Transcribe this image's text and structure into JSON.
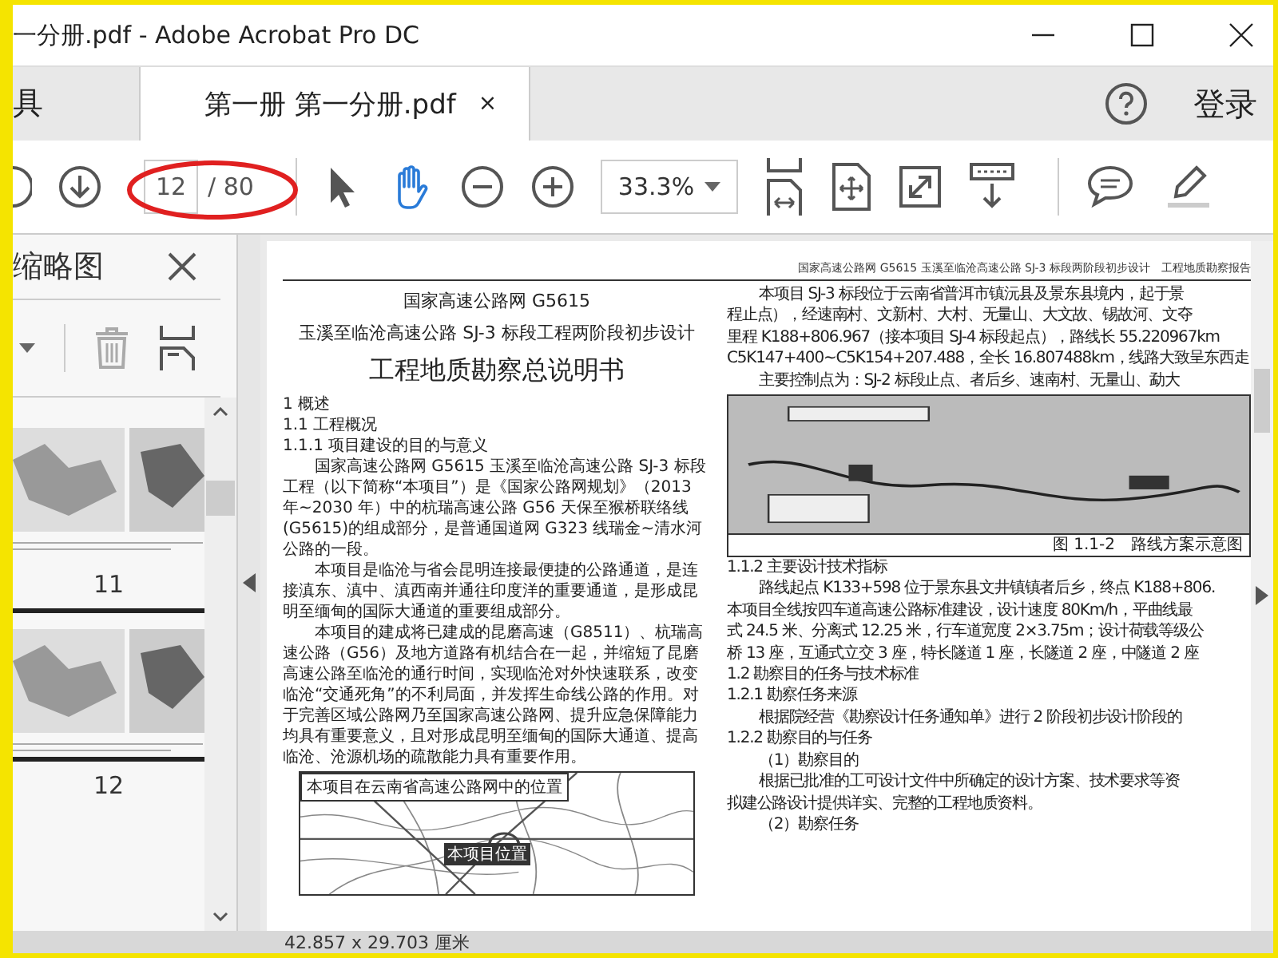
{
  "window": {
    "title": "一分册.pdf - Adobe Acrobat Pro DC"
  },
  "tabs": [
    {
      "label": "具",
      "selected": false
    },
    {
      "label": "第一册 第一分册.pdf",
      "selected": true,
      "close": "×"
    }
  ],
  "account": {
    "label": "登录"
  },
  "toolbar": {
    "page": "12",
    "total": "/ 80",
    "zoom": "33.3%",
    "tools": [
      {
        "kind": "select",
        "selected": false
      },
      {
        "kind": "hand",
        "selected": true
      }
    ]
  },
  "sidebar": {
    "title": "缩略图",
    "thumbnails": [
      {
        "label": "11",
        "selected": false
      },
      {
        "label": "12",
        "selected": true
      }
    ]
  },
  "document": {
    "header": "国家高速公路网 G5615 玉溪至临沧高速公路 SJ-3 标段两阶段初步设计　工程地质勘察报告",
    "titles": [
      "国家高速公路网 G5615",
      "玉溪至临沧高速公路 SJ-3 标段工程两阶段初步设计",
      "工程地质勘察总说明书"
    ],
    "left": [
      {
        "kind": "heading",
        "text": "1 概述"
      },
      {
        "kind": "heading",
        "text": "1.1 工程概况"
      },
      {
        "kind": "heading",
        "text": "1.1.1 项目建设的目的与意义"
      },
      {
        "kind": "para",
        "text": "国家高速公路网 G5615 玉溪至临沧高速公路 SJ-3 标段工程（以下简称“本项目”）是《国家公路网规划》（2013 年~2030 年）中的杭瑞高速公路 G56 天保至猴桥联络线(G5615)的组成部分，是普通国道网 G323 线瑞金~清水河公路的一段。"
      },
      {
        "kind": "para",
        "text": "本项目是临沧与省会昆明连接最便捷的公路通道，是连接滇东、滇中、滇西南并通往印度洋的重要通道，是形成昆明至缅甸的国际大通道的重要组成部分。"
      },
      {
        "kind": "para",
        "text": "本项目的建成将已建成的昆磨高速（G8511）、杭瑞高速公路（G56）及地方道路有机结合在一起，并缩短了昆磨高速公路至临沧的通行时间，实现临沧对外快速联系，改变临沧“交通死角”的不利局面，并发挥生命线公路的作用。对于完善区域公路网乃至国家高速公路网、提升应急保障能力均具有重要意义，且对形成昆明至缅甸的国际大通道、提高临沧、沧源机场的疏散能力具有重要作用。"
      }
    ],
    "map": {
      "title": "本项目在云南省高速公路网中的位置",
      "label": "本项目位置"
    },
    "right_top": [
      {
        "kind": "para",
        "text": "本项目 SJ-3 标段位于云南省普洱市镇沅县及景东县境内，起于景"
      },
      {
        "kind": "line",
        "text": "程止点），经速南村、文新村、大村、无量山、大文故、锡故河、文夺"
      },
      {
        "kind": "line",
        "text": "里程 K188+806.967（接本项目 SJ-4 标段起点），路线长 55.220967km"
      },
      {
        "kind": "line",
        "text": "C5K147+400~C5K154+207.488，全长 16.807488km，线路大致呈东西走"
      },
      {
        "kind": "para",
        "text": "主要控制点为：SJ-2 标段止点、者后乡、速南村、无量山、勐大"
      }
    ],
    "figure_caption": "图 1.1-2　路线方案示意图",
    "right_bottom": [
      {
        "kind": "heading",
        "text": "1.1.2 主要设计技术指标"
      },
      {
        "kind": "para",
        "text": "路线起点 K133+598 位于景东县文井镇镇者后乡，终点 K188+806."
      },
      {
        "kind": "line",
        "text": "本项目全线按四车道高速公路标准建设，设计速度 80Km/h，平曲线最"
      },
      {
        "kind": "line",
        "text": "式 24.5 米、分离式 12.25 米，行车道宽度 2×3.75m；设计荷载等级公"
      },
      {
        "kind": "line",
        "text": "桥 13 座，互通式立交 3 座，特长隧道 1 座，长隧道 2 座，中隧道 2 座"
      },
      {
        "kind": "heading",
        "text": "1.2 勘察目的任务与技术标准"
      },
      {
        "kind": "heading",
        "text": "1.2.1 勘察任务来源"
      },
      {
        "kind": "para",
        "text": "根据院经营《勘察设计任务通知单》进行 2 阶段初步设计阶段的"
      },
      {
        "kind": "heading",
        "text": "1.2.2 勘察目的与任务"
      },
      {
        "kind": "para",
        "text": "（1）勘察目的"
      },
      {
        "kind": "para",
        "text": "根据已批准的工可设计文件中所确定的设计方案、技术要求等资"
      },
      {
        "kind": "line",
        "text": "拟建公路设计提供详实、完整的工程地质资料。"
      },
      {
        "kind": "para",
        "text": "（2）勘察任务"
      }
    ]
  },
  "status_bar": {
    "size": "42.857 x 29.703 厘米"
  }
}
